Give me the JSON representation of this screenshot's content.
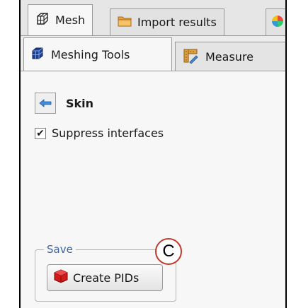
{
  "top_tabs": [
    {
      "label": "Mesh",
      "icon": "mesh-grid-icon",
      "active": true
    },
    {
      "label": "Import results",
      "icon": "folder-icon",
      "active": false
    }
  ],
  "sub_tabs": [
    {
      "label": "Meshing Tools",
      "icon": "mesh-cube-icon",
      "active": true
    },
    {
      "label": "Measure",
      "icon": "measure-ruler-icon",
      "active": false
    }
  ],
  "panel": {
    "back_icon": "back-arrow-icon",
    "title": "Skin",
    "suppress_interfaces": {
      "label": "Suppress interfaces",
      "checked": true,
      "check_glyph": "✔"
    }
  },
  "save_group": {
    "legend": "Save",
    "create_pids_label": "Create PIDs",
    "create_pids_icon": "red-cube-icon"
  },
  "callout": {
    "label": "C",
    "color": "#c0392b"
  }
}
